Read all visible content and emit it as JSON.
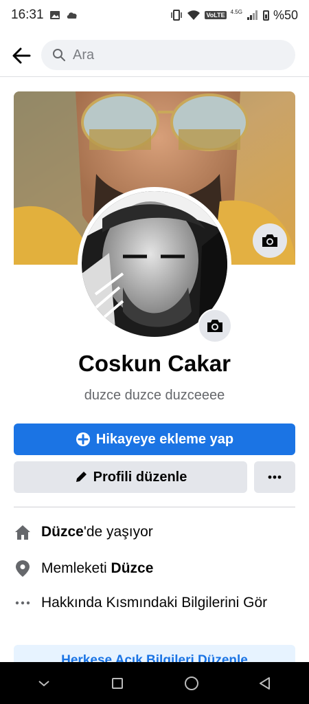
{
  "status_bar": {
    "time": "16:31",
    "network": "4.5G",
    "volte": "VoLTE",
    "battery": "%50"
  },
  "search": {
    "placeholder": "Ara"
  },
  "profile": {
    "name": "Coskun Cakar",
    "bio": "duzce duzce duzceeee"
  },
  "actions": {
    "add_story": "Hikayeye ekleme yap",
    "edit_profile": "Profili düzenle"
  },
  "details": {
    "lives_city": "Düzce",
    "lives_suffix": "'de yaşıyor",
    "hometown_prefix": "Memleketi ",
    "hometown_city": "Düzce",
    "about_link": "Hakkında Kısmındaki Bilgilerini Gör"
  },
  "public_info_button": "Herkese Açık Bilgileri Düzenle",
  "colors": {
    "accent": "#1b74e4",
    "secondary_button": "#e4e6eb",
    "muted_text": "#65676b"
  },
  "icons": [
    "back-arrow-icon",
    "search-icon",
    "camera-icon",
    "plus-circle-icon",
    "pencil-icon",
    "more-icon",
    "home-icon",
    "location-pin-icon",
    "ellipsis-icon"
  ]
}
